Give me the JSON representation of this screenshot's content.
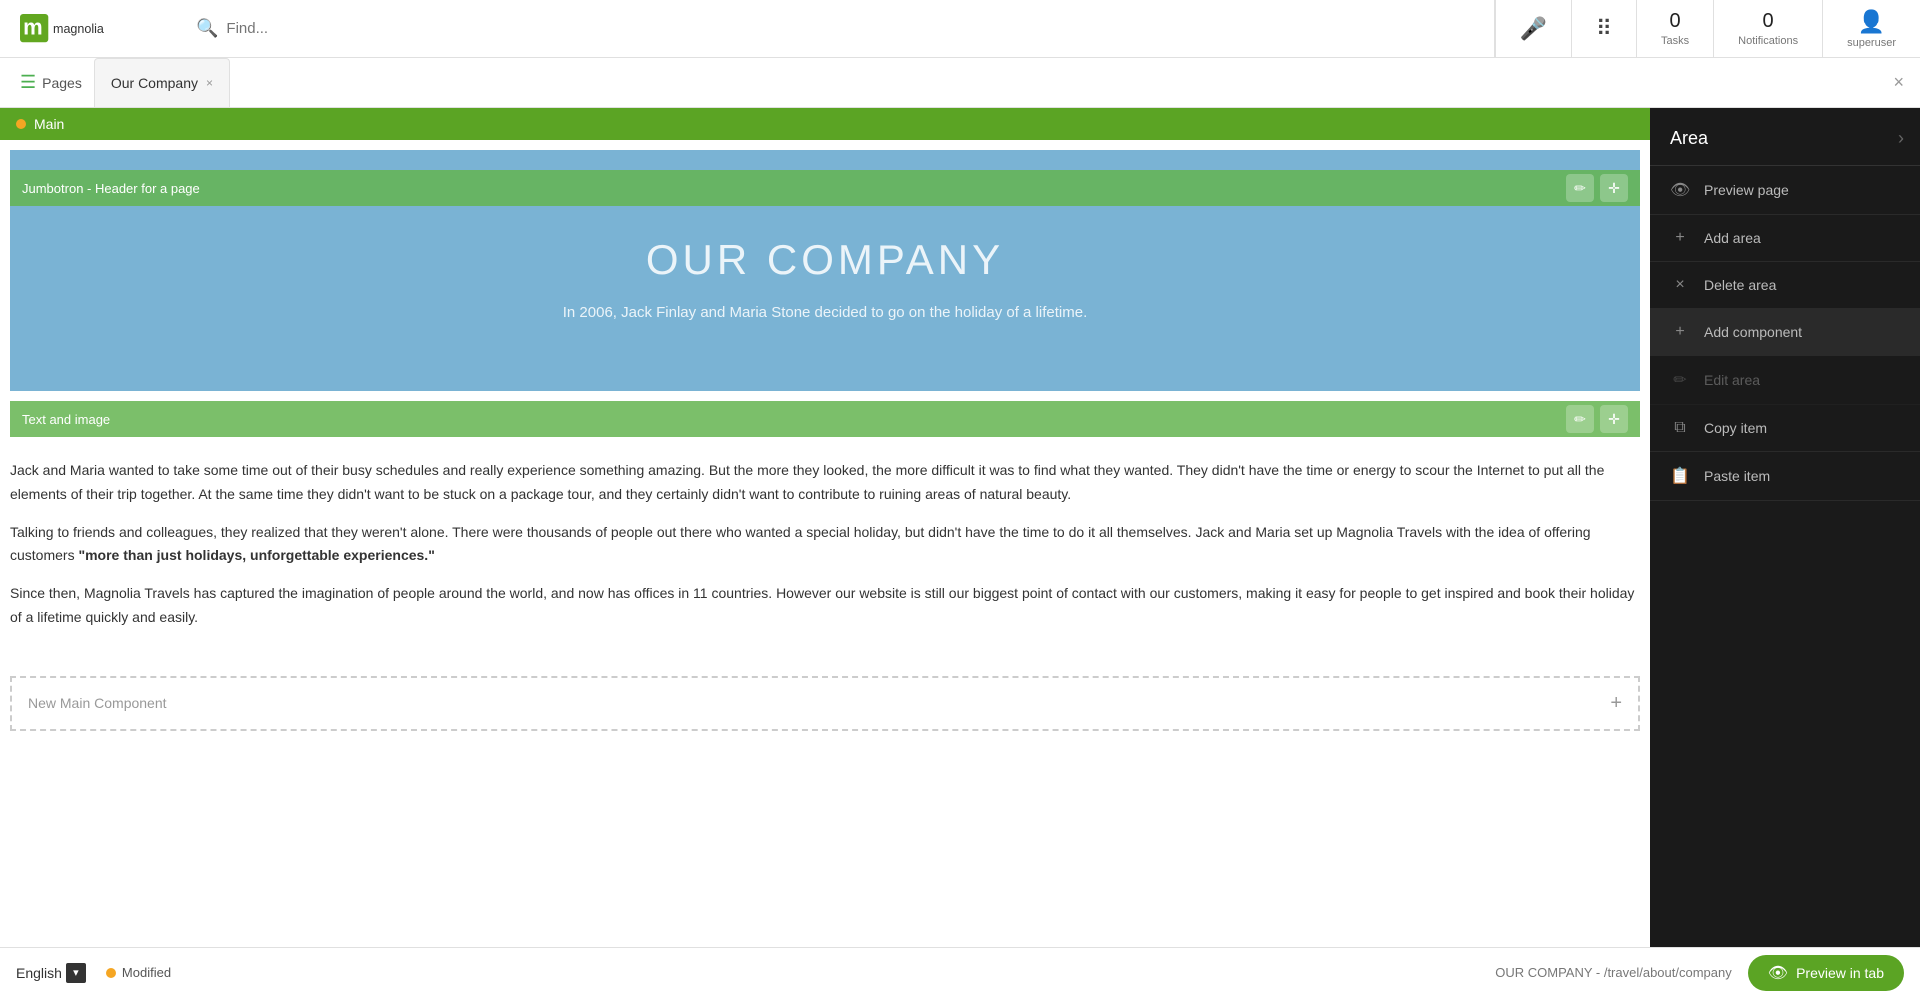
{
  "topbar": {
    "search_placeholder": "Find...",
    "tasks_count": "0",
    "tasks_label": "Tasks",
    "notifications_count": "0",
    "notifications_label": "Notifications",
    "user_label": "superuser"
  },
  "tabbar": {
    "pages_label": "Pages",
    "tab_label": "Our Company",
    "close_icon": "×"
  },
  "sidebar": {
    "title": "Area",
    "chevron": "›",
    "items": [
      {
        "id": "preview-page",
        "label": "Preview page",
        "icon": "👁"
      },
      {
        "id": "add-area",
        "label": "Add area",
        "icon": "+"
      },
      {
        "id": "delete-area",
        "label": "Delete area",
        "icon": "×"
      },
      {
        "id": "add-component",
        "label": "Add component",
        "icon": "+",
        "highlighted": true
      },
      {
        "id": "edit-area",
        "label": "Edit area",
        "icon": "✏",
        "disabled": true
      },
      {
        "id": "copy-item",
        "label": "Copy item",
        "icon": "⧉"
      },
      {
        "id": "paste-item",
        "label": "Paste item",
        "icon": "📋"
      }
    ]
  },
  "canvas": {
    "main_area_label": "Main",
    "jumbotron": {
      "bar_label": "Jumbotron - Header for a page",
      "title": "OUR COMPANY",
      "subtitle": "In 2006, Jack Finlay and Maria Stone decided to go on the holiday of a lifetime."
    },
    "text_image": {
      "bar_label": "Text and image",
      "paragraphs": [
        "Jack and Maria wanted to take some time out of their busy schedules and really experience something amazing. But the more they looked, the more difficult it was to find what they wanted. They didn't have the time or energy to scour the Internet to put all the elements of their trip together. At the same time they didn't want to be stuck on a package tour, and they certainly didn't want to contribute to ruining areas of natural beauty.",
        "Talking to friends and colleagues, they realized that they weren't alone. There were thousands of people out there who wanted a special holiday, but didn't have the time to do it all themselves. Jack and Maria set up Magnolia Travels with the idea of offering customers \"more than just holidays, unforgettable experiences.\"",
        "Since then, Magnolia Travels has captured the imagination of people around the world, and now has offices in 11 countries. However our website is still our biggest point of contact with our customers, making it easy for people to get inspired and book their holiday of a lifetime quickly and easily."
      ],
      "bold_phrase": "\"more than just holidays, unforgettable experiences.\""
    },
    "new_component_label": "New Main Component",
    "new_component_plus": "+"
  },
  "bottombar": {
    "language": "English",
    "dropdown_icon": "▾",
    "modified_label": "Modified",
    "page_path": "OUR COMPANY - /travel/about/company",
    "preview_btn_label": "Preview in tab"
  }
}
